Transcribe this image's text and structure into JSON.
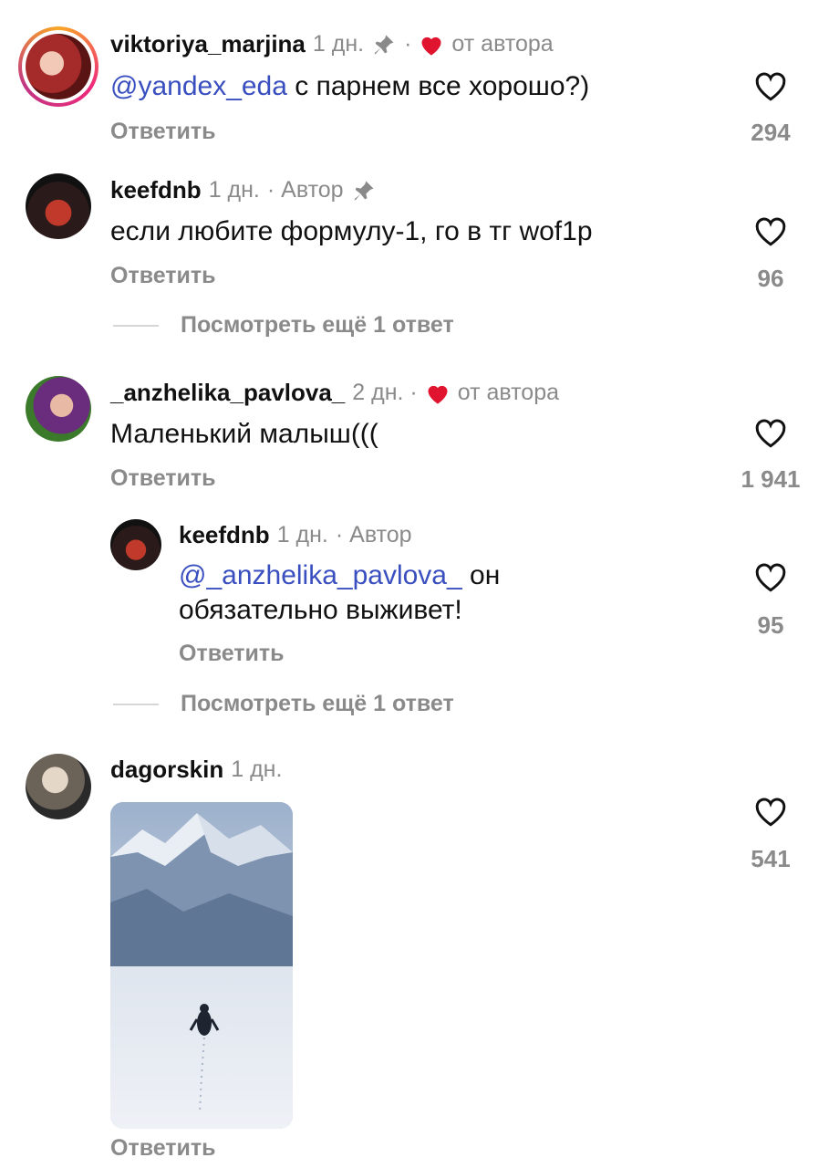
{
  "comments": [
    {
      "username": "viktoriya_marjina",
      "time": "1 дн.",
      "liked_by_author": "от автора",
      "mention": "@yandex_eda",
      "text": " с парнем все хорошо?)",
      "reply": "Ответить",
      "likes": "294"
    },
    {
      "username": "keefdnb",
      "time": "1 дн.",
      "author_badge": "· Автор",
      "text": "если любите формулу-1, го в тг wof1p",
      "reply": "Ответить",
      "likes": "96",
      "view_more": "Посмотреть ещё 1 ответ"
    },
    {
      "username": "_anzhelika_pavlova_",
      "time": "2 дн. ·",
      "liked_by_author": "от автора",
      "text": "Маленький малыш(((",
      "reply": "Ответить",
      "likes": "1 941"
    },
    {
      "username": "keefdnb",
      "time": "1 дн.",
      "author_badge": "· Автор",
      "mention": "@_anzhelika_pavlova_",
      "text_line1": " он",
      "text_line2": "обязательно выживет!",
      "reply": "Ответить",
      "likes": "95",
      "view_more": "Посмотреть ещё 1 ответ"
    },
    {
      "username": "dagorskin",
      "time": "1 дн.",
      "reply": "Ответить",
      "likes": "541"
    }
  ],
  "colors": {
    "mention": "#3a4fbf",
    "heart_red": "#e0142e",
    "muted": "#8a8a8a"
  },
  "icons": [
    "pin-icon",
    "heart-filled-icon",
    "heart-outline-icon"
  ]
}
